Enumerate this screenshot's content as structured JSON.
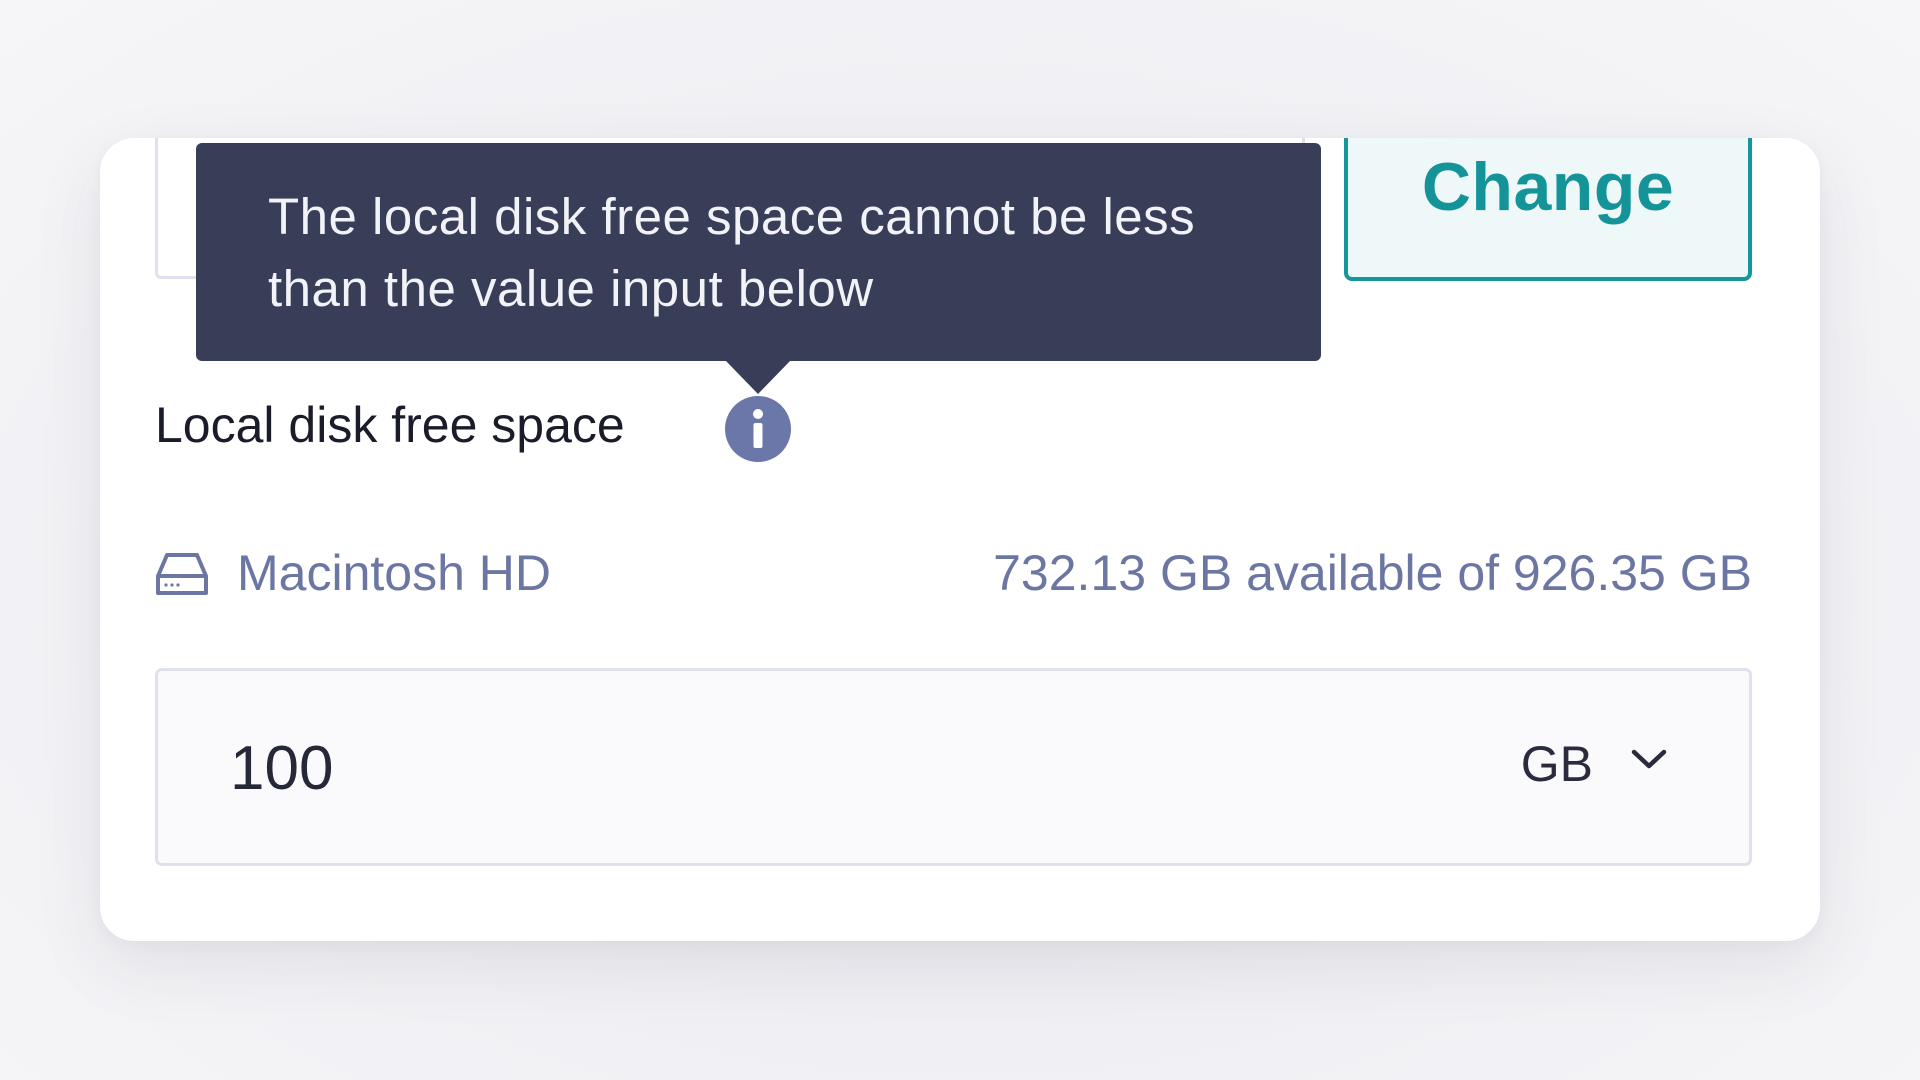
{
  "storage": {
    "change_button_label": "Change",
    "tooltip_text": "The local disk free space cannot be less than the value input below",
    "field_label": "Local disk free space",
    "disk": {
      "name": "Macintosh HD",
      "icon": "hard-drive-icon",
      "capacity_text": "732.13 GB available of 926.35 GB"
    },
    "free_space_input": {
      "value": "100",
      "unit": "GB"
    }
  },
  "colors": {
    "accent": "#14969a",
    "tooltip_bg": "#383e58",
    "info_icon": "#6b77a8",
    "muted_text": "#6b76a3"
  }
}
